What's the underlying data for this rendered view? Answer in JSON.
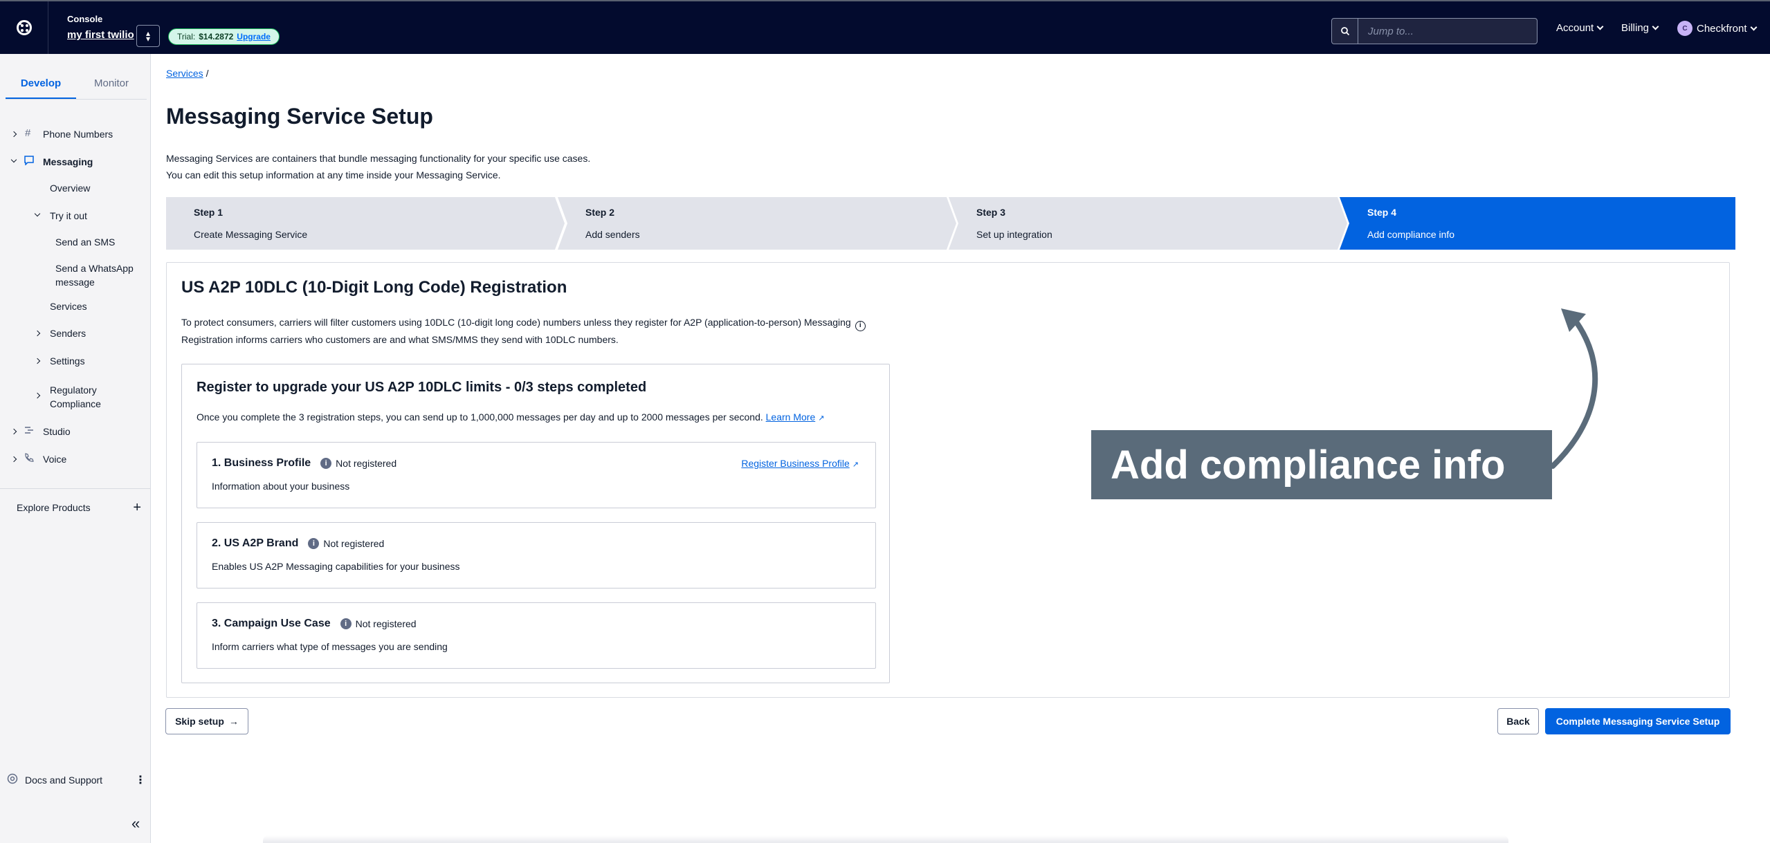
{
  "topbar": {
    "console_label": "Console",
    "account_name": "my first twilio",
    "trial_prefix": "Trial:",
    "trial_amount": "$14.2872",
    "upgrade_label": "Upgrade",
    "search_placeholder": "Jump to...",
    "account_menu": "Account",
    "billing_menu": "Billing",
    "user_initial": "C",
    "user_name": "Checkfront"
  },
  "sidebar": {
    "tabs": [
      {
        "label": "Develop",
        "active": true
      },
      {
        "label": "Monitor",
        "active": false
      }
    ],
    "items": {
      "phone_numbers": "Phone Numbers",
      "messaging": "Messaging",
      "overview": "Overview",
      "try_it_out": "Try it out",
      "send_sms": "Send an SMS",
      "send_whatsapp_1": "Send a WhatsApp",
      "send_whatsapp_2": "message",
      "services": "Services",
      "senders": "Senders",
      "settings": "Settings",
      "regulatory_1": "Regulatory",
      "regulatory_2": "Compliance",
      "studio": "Studio",
      "voice": "Voice"
    },
    "explore_label": "Explore Products",
    "docs_label": "Docs and Support"
  },
  "main": {
    "breadcrumb_link": "Services",
    "breadcrumb_sep": "/",
    "title": "Messaging Service Setup",
    "intro_line1": "Messaging Services are containers that bundle messaging functionality for your specific use cases.",
    "intro_line2": "You can edit this setup information at any time inside your Messaging Service.",
    "steps": [
      {
        "num": "Step 1",
        "label": "Create Messaging Service",
        "active": false
      },
      {
        "num": "Step 2",
        "label": "Add senders",
        "active": false
      },
      {
        "num": "Step 3",
        "label": "Set up integration",
        "active": false
      },
      {
        "num": "Step 4",
        "label": "Add compliance info",
        "active": true
      }
    ],
    "registration": {
      "title": "US A2P 10DLC (10-Digit Long Code) Registration",
      "desc_line1": "To protect consumers, carriers will filter customers using 10DLC (10-digit long code) numbers unless they register for A2P (application-to-person) Messaging",
      "desc_line2": "Registration informs carriers who customers are and what SMS/MMS they send with 10DLC numbers.",
      "box_title": "Register to upgrade your US A2P 10DLC limits - 0/3 steps completed",
      "box_desc": "Once you complete the 3 registration steps, you can send up to 1,000,000 messages per day and up to 2000 messages per second.",
      "learn_more": "Learn More",
      "steps": [
        {
          "title": "1. Business Profile",
          "status": "Not registered",
          "desc": "Information about your business",
          "link": "Register Business Profile"
        },
        {
          "title": "2. US A2P Brand",
          "status": "Not registered",
          "desc": "Enables US A2P Messaging capabilities for your business"
        },
        {
          "title": "3. Campaign Use Case",
          "status": "Not registered",
          "desc": "Inform carriers what type of messages you are sending"
        }
      ]
    },
    "callout": "Add compliance info",
    "buttons": {
      "skip": "Skip setup",
      "back": "Back",
      "complete": "Complete Messaging Service Setup"
    }
  },
  "colors": {
    "topbar_bg": "#030b2e",
    "primary": "#0263e0",
    "step_inactive": "#e1e3ea",
    "callout_bg": "#5a6b7a"
  }
}
